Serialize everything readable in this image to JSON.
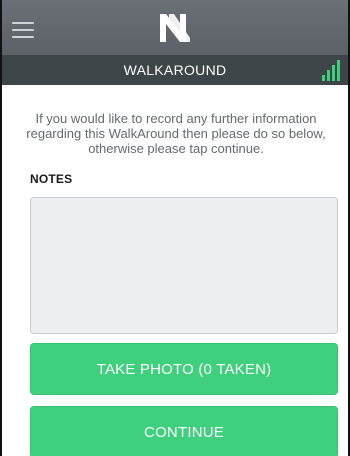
{
  "header": {
    "logo_letter": "N",
    "menu_icon": "hamburger-menu-icon"
  },
  "subheader": {
    "title": "WALKAROUND",
    "signal_icon": "signal-strength-icon",
    "signal_color": "#3fd07d"
  },
  "content": {
    "intro_text": "If you would like to record any further information regarding this WalkAround then please do so below, otherwise please tap continue.",
    "notes_label": "NOTES",
    "notes_value": ""
  },
  "actions": {
    "take_photo_label": "TAKE PHOTO (0 TAKEN)",
    "continue_label": "CONTINUE"
  },
  "colors": {
    "topbar": "#5f6569",
    "subbar": "#3e4549",
    "button": "#3fd07d"
  }
}
